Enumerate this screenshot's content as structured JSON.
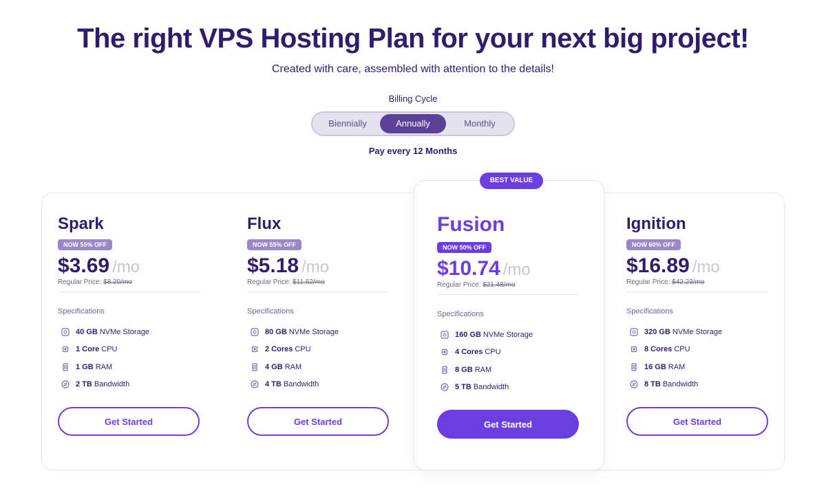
{
  "header": {
    "title": "The right VPS Hosting Plan for your next big project!",
    "subtitle": "Created with care, assembled with attention to the details!"
  },
  "billing": {
    "label": "Billing Cycle",
    "options": [
      "Biennially",
      "Annually",
      "Monthly"
    ],
    "selected": "Annually",
    "note": "Pay every 12 Months"
  },
  "plans": [
    {
      "name": "Spark",
      "discount": "NOW 55% OFF",
      "price": "$3.69",
      "per": "/mo",
      "regular_label": "Regular Price:",
      "regular_price": "$8.20/mo",
      "spec_title": "Specifications",
      "specs": [
        {
          "icon": "storage-icon",
          "value": "40 GB",
          "label": "NVMe Storage"
        },
        {
          "icon": "cpu-icon",
          "value": "1 Core",
          "label": "CPU"
        },
        {
          "icon": "ram-icon",
          "value": "1 GB",
          "label": "RAM"
        },
        {
          "icon": "bandwidth-icon",
          "value": "2 TB",
          "label": "Bandwidth"
        }
      ],
      "button": "Get Started"
    },
    {
      "name": "Flux",
      "discount": "NOW 55% OFF",
      "price": "$5.18",
      "per": "/mo",
      "regular_label": "Regular Price:",
      "regular_price": "$11.52/mo",
      "spec_title": "Specifications",
      "specs": [
        {
          "icon": "storage-icon",
          "value": "80 GB",
          "label": "NVMe Storage"
        },
        {
          "icon": "cpu-icon",
          "value": "2 Cores",
          "label": "CPU"
        },
        {
          "icon": "ram-icon",
          "value": "4 GB",
          "label": "RAM"
        },
        {
          "icon": "bandwidth-icon",
          "value": "4 TB",
          "label": "Bandwidth"
        }
      ],
      "button": "Get Started"
    },
    {
      "name": "Fusion",
      "badge": "BEST VALUE",
      "discount": "NOW 50% OFF",
      "price": "$10.74",
      "per": "/mo",
      "regular_label": "Regular Price:",
      "regular_price": "$21.48/mo",
      "spec_title": "Specifications",
      "specs": [
        {
          "icon": "storage-icon",
          "value": "160 GB",
          "label": "NVMe Storage"
        },
        {
          "icon": "cpu-icon",
          "value": "4 Cores",
          "label": "CPU"
        },
        {
          "icon": "ram-icon",
          "value": "8 GB",
          "label": "RAM"
        },
        {
          "icon": "bandwidth-icon",
          "value": "5 TB",
          "label": "Bandwidth"
        }
      ],
      "button": "Get Started"
    },
    {
      "name": "Ignition",
      "discount": "NOW 60% OFF",
      "price": "$16.89",
      "per": "/mo",
      "regular_label": "Regular Price:",
      "regular_price": "$42.23/mo",
      "spec_title": "Specifications",
      "specs": [
        {
          "icon": "storage-icon",
          "value": "320 GB",
          "label": "NVMe Storage"
        },
        {
          "icon": "cpu-icon",
          "value": "8 Cores",
          "label": "CPU"
        },
        {
          "icon": "ram-icon",
          "value": "16 GB",
          "label": "RAM"
        },
        {
          "icon": "bandwidth-icon",
          "value": "8 TB",
          "label": "Bandwidth"
        }
      ],
      "button": "Get Started"
    }
  ],
  "colors": {
    "brand": "#6a3ee0",
    "heading": "#2f1c6a",
    "toggle_active": "#5a4296",
    "discount_badge": "#9a86c8"
  }
}
